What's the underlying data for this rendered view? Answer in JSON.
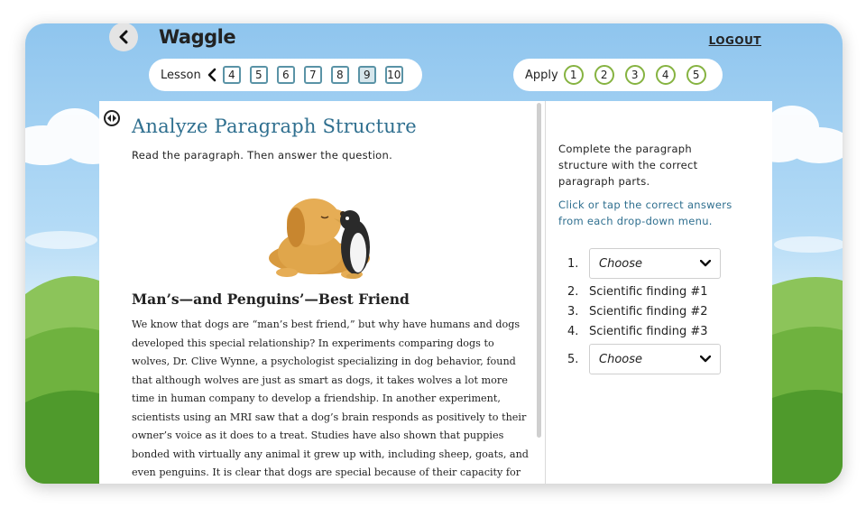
{
  "header": {
    "logo": "Waggle",
    "logout_label": "LOGOUT"
  },
  "lesson_nav": {
    "label": "Lesson",
    "items": [
      {
        "label": "4",
        "done": false
      },
      {
        "label": "5",
        "done": false
      },
      {
        "label": "6",
        "done": false
      },
      {
        "label": "7",
        "done": false
      },
      {
        "label": "8",
        "done": false
      },
      {
        "label": "9",
        "done": true
      },
      {
        "label": "10",
        "done": false
      }
    ]
  },
  "apply_nav": {
    "label": "Apply",
    "items": [
      "1",
      "2",
      "3",
      "4",
      "5"
    ]
  },
  "content": {
    "title": "Analyze Paragraph Structure",
    "instruction": "Read the paragraph. Then answer the question.",
    "subtitle": "Man’s—and Penguins’—Best Friend",
    "paragraph_lines": [
      "We know that dogs are “man’s best friend,” but why have humans and dogs",
      "developed this special relationship? In experiments comparing dogs to",
      "wolves, Dr. Clive Wynne, a psychologist specializing in dog behavior, found",
      "that although wolves are just as smart as dogs, it takes wolves a lot more",
      "time in human company to develop a friendship. In another experiment,",
      "scientists using an MRI saw that a dog’s brain responds as positively to their",
      "owner’s voice as it does to a treat. Studies have also shown that puppies",
      "bonded with virtually any animal it grew up with, including sheep, goats, and",
      "even penguins. It is clear that dogs are special because of their capacity for"
    ]
  },
  "question": {
    "prompt_lines": [
      "Complete the paragraph",
      "structure with the correct",
      "paragraph parts."
    ],
    "hint_lines": [
      "Click or tap the correct answers",
      "from each drop-down menu."
    ],
    "answers": [
      {
        "num": "1.",
        "type": "dropdown",
        "value": "Choose"
      },
      {
        "num": "2.",
        "type": "text",
        "value": "Scientific finding #1"
      },
      {
        "num": "3.",
        "type": "text",
        "value": "Scientific finding #2"
      },
      {
        "num": "4.",
        "type": "text",
        "value": "Scientific finding #3"
      },
      {
        "num": "5.",
        "type": "dropdown",
        "value": "Choose"
      }
    ]
  },
  "colors": {
    "title": "#2f6f8f",
    "lesson_border": "#5a93a6",
    "apply_border": "#86b341"
  }
}
